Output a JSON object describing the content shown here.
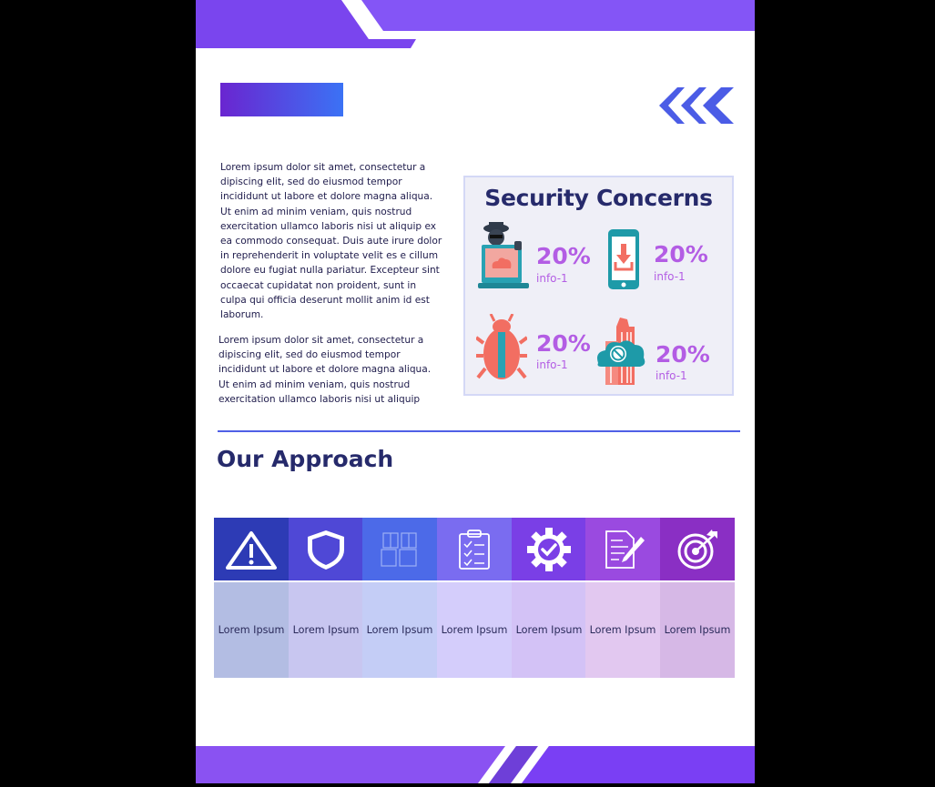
{
  "body_text": [
    "Lorem ipsum dolor sit amet, consectetur a dipiscing elit, sed do eiusmod tempor incididunt ut labore et dolore magna aliqua. Ut enim ad minim veniam, quis nostrud exercitation ullamco laboris nisi ut aliquip ex ea commodo consequat. Duis aute irure dolor in reprehenderit in voluptate velit es e cillum dolore eu fugiat nulla pariatur. Excepteur sint occaecat cupidatat non proident, sunt in culpa qui officia deserunt mollit anim id est laborum.",
    "Lorem ipsum dolor sit amet, consectetur a dipiscing elit, sed do eiusmod tempor incididunt ut labore et dolore magna aliqua. Ut enim ad minim veniam, quis nostrud exercitation ullamco laboris nisi ut aliquip"
  ],
  "security": {
    "title": "Security Concerns",
    "items": [
      {
        "icon": "hacker-laptop-icon",
        "percent": "20%",
        "info": "info-1"
      },
      {
        "icon": "phone-download-icon",
        "percent": "20%",
        "info": "info-1"
      },
      {
        "icon": "bug-icon",
        "percent": "20%",
        "info": "info-1"
      },
      {
        "icon": "cloud-blocked-icon",
        "percent": "20%",
        "info": "info-1"
      }
    ]
  },
  "approach": {
    "title": "Our Approach",
    "items": [
      {
        "icon": "warning-icon",
        "label": "Lorem Ipsum",
        "top_color": "#2d3bb5",
        "bottom_color": "#b3bde3"
      },
      {
        "icon": "shield-icon",
        "label": "Lorem Ipsum",
        "top_color": "#4f48d6",
        "bottom_color": "#c8c6f0"
      },
      {
        "icon": "boxes-icon",
        "label": "Lorem Ipsum",
        "top_color": "#4c6ae8",
        "bottom_color": "#c4cdf6"
      },
      {
        "icon": "checklist-icon",
        "label": "Lorem Ipsum",
        "top_color": "#7a6cf0",
        "bottom_color": "#d4cdfb"
      },
      {
        "icon": "gear-check-icon",
        "label": "Lorem Ipsum",
        "top_color": "#7a3fe6",
        "bottom_color": "#d3c2f6"
      },
      {
        "icon": "document-pen-icon",
        "label": "Lorem Ipsum",
        "top_color": "#9a4ae0",
        "bottom_color": "#e2c8f0"
      },
      {
        "icon": "target-icon",
        "label": "Lorem Ipsum",
        "top_color": "#8a2fc4",
        "bottom_color": "#d6b8e6"
      }
    ]
  },
  "colors": {
    "accent_purple": "#7c4dff",
    "accent_blue": "#3a5de8",
    "navy": "#262a6b",
    "magenta": "#b35de4"
  }
}
